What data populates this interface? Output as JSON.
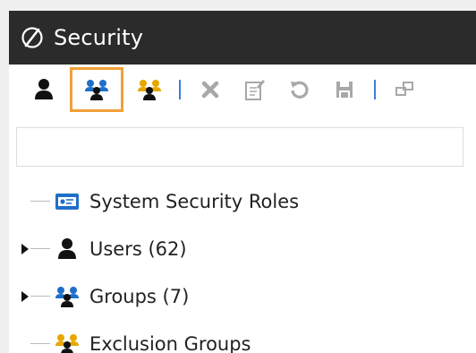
{
  "window": {
    "title": "Security"
  },
  "colors": {
    "titlebar": "#2b2b2b",
    "active_outline": "#f0a038",
    "separator": "#3b7fd8",
    "group_blue": "#1f6fc9",
    "group_yellow": "#e6a800",
    "disabled_gray": "#a8a8a8"
  },
  "toolbar": {
    "buttons": [
      {
        "name": "user-icon",
        "state": "enabled"
      },
      {
        "name": "group-icon",
        "state": "selected"
      },
      {
        "name": "exclusion-group-icon",
        "state": "enabled"
      },
      {
        "name": "delete-icon",
        "state": "disabled"
      },
      {
        "name": "edit-icon",
        "state": "disabled"
      },
      {
        "name": "refresh-icon",
        "state": "disabled"
      },
      {
        "name": "save-icon",
        "state": "disabled"
      },
      {
        "name": "link-icon",
        "state": "disabled"
      }
    ]
  },
  "search": {
    "value": "",
    "placeholder": ""
  },
  "tree": {
    "items": [
      {
        "label": "System Security Roles",
        "icon": "security-role-icon",
        "expandable": false
      },
      {
        "label": "Users (62)",
        "icon": "user-icon",
        "expandable": true
      },
      {
        "label": "Groups (7)",
        "icon": "group-icon",
        "expandable": true
      },
      {
        "label": "Exclusion Groups",
        "icon": "exclusion-group-icon",
        "expandable": false
      }
    ]
  }
}
